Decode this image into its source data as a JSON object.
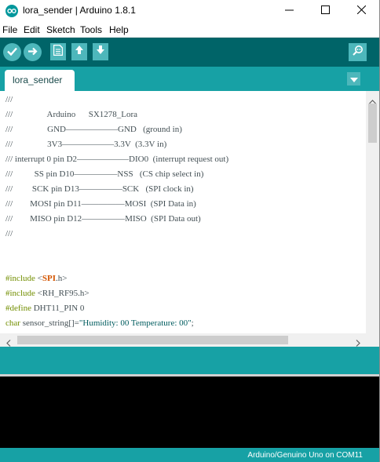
{
  "window": {
    "title": "lora_sender | Arduino 1.8.1",
    "controls": {
      "minimize": "minimize-icon",
      "maximize": "maximize-icon",
      "close": "close-icon"
    }
  },
  "menu": [
    "File",
    "Edit",
    "Sketch",
    "Tools",
    "Help"
  ],
  "toolbar": {
    "buttons": [
      "verify-icon",
      "upload-icon",
      "new-icon",
      "open-icon",
      "save-icon"
    ],
    "right": "serial-monitor-icon"
  },
  "tabs": [
    {
      "label": "lora_sender"
    }
  ],
  "editor": {
    "lines": [
      "///",
      "///                Arduino      SX1278_Lora",
      "///                GND——————GND   (ground in)",
      "///                3V3——————3.3V  (3.3V in)",
      "/// interrupt 0 pin D2——————DIO0  (interrupt request out)",
      "///          SS pin D10—————NSS   (CS chip select in)",
      "///         SCK pin D13—————SCK   (SPI clock in)",
      "///        MOSI pin D11—————MOSI  (SPI Data in)",
      "///        MISO pin D12—————MISO  (SPI Data out)",
      "///",
      "",
      "",
      "#include <SPI.h>",
      "#include <RH_RF95.h>",
      "#define DHT11_PIN 0",
      "char sensor_string[]=\"Humidity: 00 Temperature: 00\";"
    ]
  },
  "status": {
    "board": "Arduino/Genuino Uno on COM11"
  },
  "colors": {
    "toolbar": "#006468",
    "tabbar": "#17a1a5",
    "button": "#4db7bb",
    "keyword": "#d35400",
    "preprocessor": "#728e00",
    "console": "#000000"
  }
}
